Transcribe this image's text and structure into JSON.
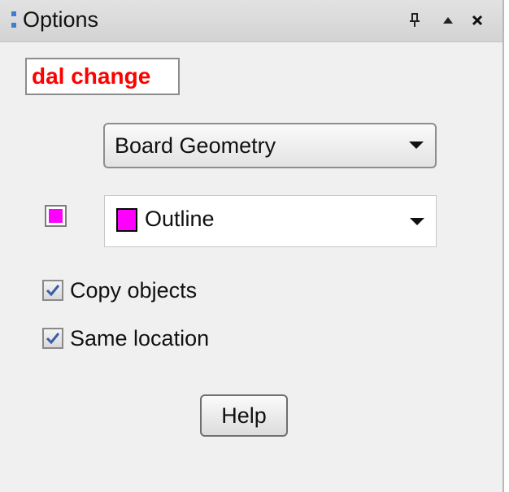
{
  "panel": {
    "title": "Options",
    "titlebar_buttons": [
      "pin-icon",
      "collapse-icon",
      "close-icon"
    ]
  },
  "status_label": {
    "text": "dal change",
    "color": "#ff0000"
  },
  "class_select": {
    "value": "Board Geometry"
  },
  "subclass_select": {
    "value": "Outline",
    "color": "#ff00ff"
  },
  "options": {
    "copy_objects": {
      "label": "Copy objects",
      "checked": true
    },
    "same_location": {
      "label": "Same location",
      "checked": true
    }
  },
  "help_button": {
    "label": "Help"
  },
  "colors": {
    "accent": "#3a7fd6",
    "check": "#3c5da8",
    "subclass_color": "#ff00ff"
  }
}
